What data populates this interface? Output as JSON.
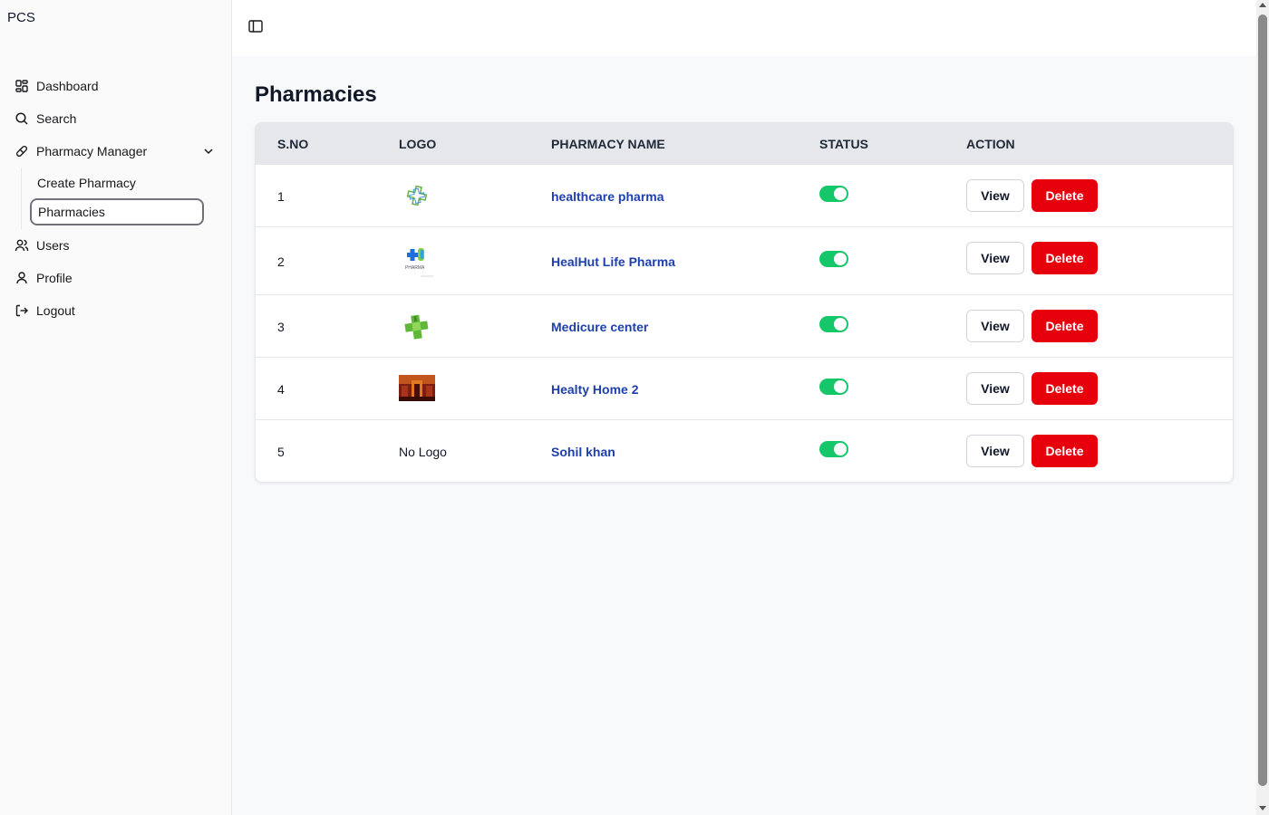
{
  "app": {
    "brand": "PCS"
  },
  "sidebar": {
    "items": [
      {
        "label": "Dashboard",
        "icon": "layout-grid-icon"
      },
      {
        "label": "Search",
        "icon": "search-icon"
      },
      {
        "label": "Pharmacy Manager",
        "icon": "pill-icon",
        "expanded": true
      },
      {
        "label": "Users",
        "icon": "users-icon"
      },
      {
        "label": "Profile",
        "icon": "user-icon"
      },
      {
        "label": "Logout",
        "icon": "logout-icon"
      }
    ],
    "subitems": [
      {
        "label": "Create Pharmacy",
        "active": false
      },
      {
        "label": "Pharmacies",
        "active": true
      }
    ]
  },
  "page": {
    "title": "Pharmacies"
  },
  "table": {
    "headers": {
      "sno": "S.NO",
      "logo": "LOGO",
      "name": "PHARMACY NAME",
      "status": "STATUS",
      "action": "ACTION"
    },
    "view_label": "View",
    "delete_label": "Delete",
    "rows": [
      {
        "sno": "1",
        "logo_type": "cross-outline",
        "logo_text": "",
        "name": "healthcare pharma",
        "status_on": true
      },
      {
        "sno": "2",
        "logo_type": "blue-green-plus",
        "logo_text": "",
        "name": "HealHut Life Pharma",
        "status_on": true
      },
      {
        "sno": "3",
        "logo_type": "green-cross",
        "logo_text": "",
        "name": "Medicure center",
        "status_on": true
      },
      {
        "sno": "4",
        "logo_type": "photo",
        "logo_text": "",
        "name": "Healty Home 2",
        "status_on": true
      },
      {
        "sno": "5",
        "logo_type": "none",
        "logo_text": "No Logo",
        "name": "Sohil khan",
        "status_on": true
      }
    ]
  },
  "colors": {
    "accent_link": "#1e40af",
    "toggle_on": "#16c76a",
    "delete": "#e7000b",
    "header_bg": "#e5e7eb"
  }
}
